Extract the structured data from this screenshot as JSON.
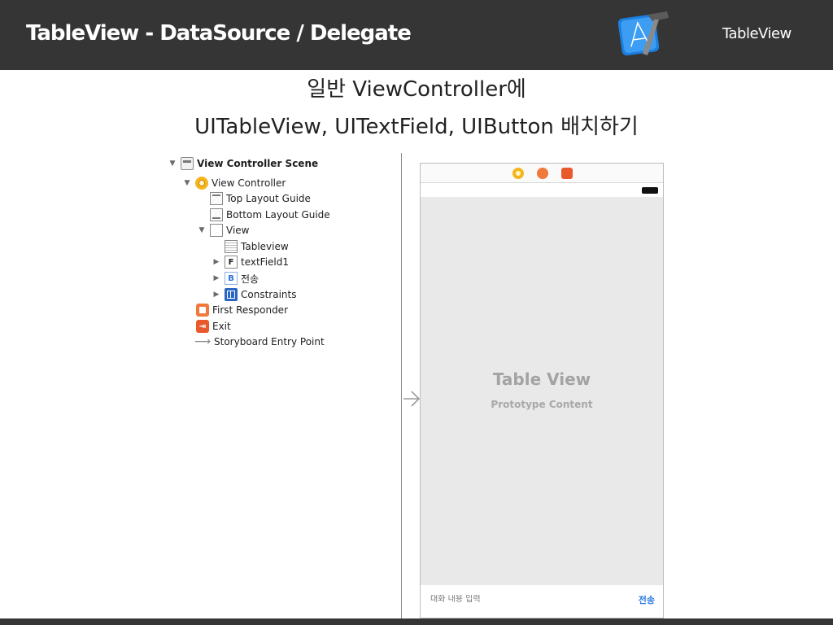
{
  "header": {
    "title": "TableView - DataSource / Delegate",
    "right_label": "TableView",
    "logo_icon": "xcode-hammer-icon",
    "background_color": "#353535"
  },
  "subtitle": {
    "line1": "일반 ViewController에",
    "line2": "UITableView, UITextField, UIButton 배치하기"
  },
  "outline": {
    "items": [
      {
        "label": "View Controller Scene",
        "icon": "scene-icon",
        "disclosure": "expanded"
      },
      {
        "label": "View Controller",
        "icon": "view-controller-icon",
        "disclosure": "expanded"
      },
      {
        "label": "Top Layout Guide",
        "icon": "layout-guide-icon"
      },
      {
        "label": "Bottom Layout Guide",
        "icon": "layout-guide-icon"
      },
      {
        "label": "View",
        "icon": "view-icon",
        "disclosure": "expanded"
      },
      {
        "label": "Tableview",
        "icon": "table-view-icon"
      },
      {
        "label": "textField1",
        "icon": "text-field-icon",
        "icon_text": "F",
        "disclosure": "collapsed"
      },
      {
        "label": "전송",
        "icon": "button-icon",
        "icon_text": "B",
        "disclosure": "collapsed"
      },
      {
        "label": "Constraints",
        "icon": "constraints-icon",
        "disclosure": "collapsed"
      },
      {
        "label": "First Responder",
        "icon": "first-responder-icon"
      },
      {
        "label": "Exit",
        "icon": "exit-icon"
      },
      {
        "label": "Storyboard Entry Point",
        "icon": "arrow-icon"
      }
    ],
    "disclosure_expanded_glyph": "▼",
    "disclosure_collapsed_glyph": "▶"
  },
  "canvas": {
    "table_view_title": "Table View",
    "table_view_subtitle": "Prototype Content",
    "text_field_placeholder": "대화 내용 입력",
    "send_button_label": "전송",
    "accent_color": "#2a7ae2"
  }
}
